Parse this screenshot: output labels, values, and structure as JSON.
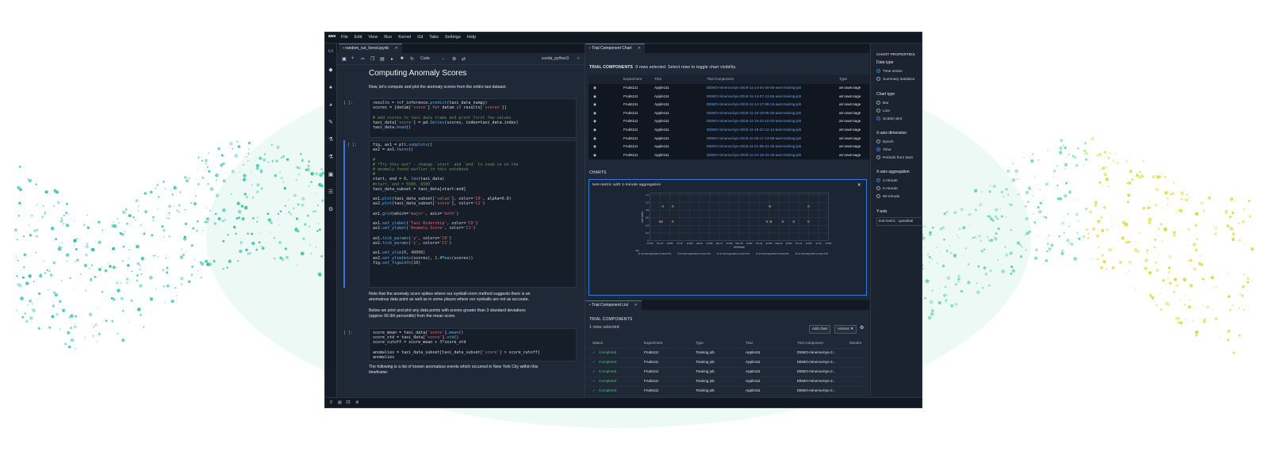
{
  "menubar": {
    "logo": "aws",
    "items": [
      "File",
      "Edit",
      "View",
      "Run",
      "Kernel",
      "Git",
      "Tabs",
      "Settings",
      "Help"
    ]
  },
  "notebook": {
    "tab_label": "random_cut_forest.ipynb",
    "cell_type": "Code",
    "kernel": "conda_python3",
    "heading": "Computing Anomaly Scores",
    "intro": "Now, let's compute and plot the anomaly scores from the entire taxi dataset.",
    "prompt": "[ ]:",
    "md2a": "Note that the anomaly score spikes where our eyeball-norm method suggests there is an",
    "md2b": "anomalous data point as well as in some places where our eyeballs are not as accurate.",
    "md3a": "Below we print and plot any data points with scores greater than 3 standard deviations",
    "md3b": "(approx 99.9th percentile) from the mean score.",
    "md4a": "The following is a list of known anomalous events which occurred in New York City within this",
    "md4b": "timeframe:"
  },
  "status": {
    "left": "0",
    "count": "23"
  },
  "chart_panel": {
    "tab_label": "Trial Component Chart",
    "tc_label": "TRIAL COMPONENTS",
    "tc_info": "9 rows selected. Select rows to toggle chart visibility.",
    "headers": [
      "Experiment",
      "Trial",
      "Trial Component",
      "Type"
    ],
    "rows": [
      [
        "Fruits111",
        "Apple111",
        "DEMO-minerva-byo-2019-11-14-04-26-00-aws-training-job",
        "arn:aws:sage"
      ],
      [
        "Fruits111",
        "Apple111",
        "DEMO-minerva-byo-2019-11-14-07-13-55-aws-training-job",
        "arn:aws:sage"
      ],
      [
        "Fruits111",
        "Apple111",
        "DEMO-minerva-byo-2019-11-14-17-08-13-aws-training-job",
        "arn:aws:sage"
      ],
      [
        "Fruits111",
        "Apple111",
        "DEMO-minerva-byo-2019-11-19-18-05-33-aws-training-job",
        "arn:aws:sage"
      ],
      [
        "Fruits111",
        "Apple111",
        "DEMO-minerva-byo-2019-11-19-22-10-02-aws-training-job",
        "arn:aws:sage"
      ],
      [
        "Fruits111",
        "Apple111",
        "DEMO-minerva-byo-2019-11-19-22-12-14-aws-training-job",
        "arn:aws:sage"
      ],
      [
        "Fruits111",
        "Apple111",
        "DEMO-minerva-byo-2019-11-20-17-13-59-aws-training-job",
        "arn:aws:sage"
      ],
      [
        "Fruits111",
        "Apple111",
        "DEMO-minerva-byo-2019-11-21-05-21-26-aws-training-job",
        "arn:aws:sage"
      ],
      [
        "Fruits111",
        "Apple111",
        "DEMO-minerva-byo-2019-11-21-18-23-16-aws-training-job",
        "arn:aws:sage"
      ]
    ],
    "charts_label": "CHARTS",
    "chart_title": "test-metric with 1-minute aggregation",
    "legend_title": "arn",
    "legend": [
      "arn:aws:sagemaker:us-west-2:33...",
      "arn:aws:sagemaker:us-west-2:33...",
      "arn:aws:sagemaker:us-west-2:33...",
      "arn:aws:sagemaker:us-west-2:33...",
      "arn:aws:sagemaker:us-west-2:33..."
    ]
  },
  "chart_data": {
    "type": "scatter",
    "title": "",
    "xlabel": "timestamp",
    "ylabel": "test-metric",
    "ylim": [
      0,
      1.25
    ],
    "yticks": [
      "0",
      "0.2",
      "0.4",
      "0.6",
      "0.8",
      "1.0",
      "1.2"
    ],
    "xticks": [
      "12 PM",
      "Thu 14",
      "12 PM",
      "Fri 15",
      "12 PM",
      "Sat 16",
      "12 PM",
      "Nov 17",
      "12 PM",
      "Mon 18",
      "12 PM",
      "Tue 19",
      "12 PM",
      "Wed 20",
      "12 PM",
      "Thu 21",
      "12 PM",
      "Fri 22",
      "12 PM"
    ],
    "grid": true,
    "points": [
      {
        "x": 1,
        "y": 0.5,
        "color": "#d08a5b"
      },
      {
        "x": 1.2,
        "y": 0.5,
        "color": "#9aa3ad"
      },
      {
        "x": 1.3,
        "y": 0.9,
        "color": "#5cb85c"
      },
      {
        "x": 2.3,
        "y": 0.9,
        "color": "#d08a5b"
      },
      {
        "x": 2.3,
        "y": 0.5,
        "color": "#d08a5b"
      },
      {
        "x": 11.8,
        "y": 0.5,
        "color": "#9aa3ad"
      },
      {
        "x": 12.1,
        "y": 0.9,
        "color": "#b7c24a"
      },
      {
        "x": 12.2,
        "y": 0.5,
        "color": "#e6c229"
      },
      {
        "x": 13.4,
        "y": 0.5,
        "color": "#9aa3ad"
      },
      {
        "x": 14.5,
        "y": 0.5,
        "color": "#9aa3ad"
      },
      {
        "x": 16.0,
        "y": 0.5,
        "color": "#d08a5b"
      },
      {
        "x": 16.0,
        "y": 0.9,
        "color": "#d08a5b"
      }
    ]
  },
  "settings": {
    "title": "CHART PROPERTIES",
    "data_type_label": "Data type",
    "data_type": [
      "Time series",
      "Summary statistics"
    ],
    "chart_type_label": "Chart type",
    "chart_type": [
      "Bar",
      "Line",
      "Scatter plot"
    ],
    "x_dim_label": "X-axis dimension",
    "x_dim": [
      "Epoch",
      "Time",
      "Periods from start"
    ],
    "x_agg_label": "X-axis aggregation",
    "x_agg": [
      "1-minute",
      "5-minute",
      "60-minute"
    ],
    "y_label": "Y-axis",
    "y_value": "test-metric - quantitati"
  },
  "list_panel": {
    "tab_label": "Trial Component List",
    "tc_label": "TRIAL COMPONENTS",
    "info": "1 rows selected",
    "add_chart": "Add chart",
    "actions": "Actions ▼",
    "headers": [
      "Status",
      "Experiment",
      "Type",
      "Trial",
      "Trial component",
      "Monitor"
    ],
    "rows": [
      [
        "Completed",
        "Fruits111",
        "Training job",
        "Apple111",
        "DEMO-minerva-byo-2..."
      ],
      [
        "Completed",
        "Fruits111",
        "Training job",
        "Apple111",
        "DEMO-minerva-byo-2..."
      ],
      [
        "Completed",
        "Fruits111",
        "Training job",
        "Apple111",
        "DEMO-minerva-byo-2..."
      ],
      [
        "Completed",
        "Fruits111",
        "Training job",
        "Apple111",
        "DEMO-minerva-byo-2..."
      ],
      [
        "Completed",
        "Fruits111",
        "Training job",
        "Apple111",
        "DEMO-minerva-byo-2..."
      ]
    ]
  }
}
